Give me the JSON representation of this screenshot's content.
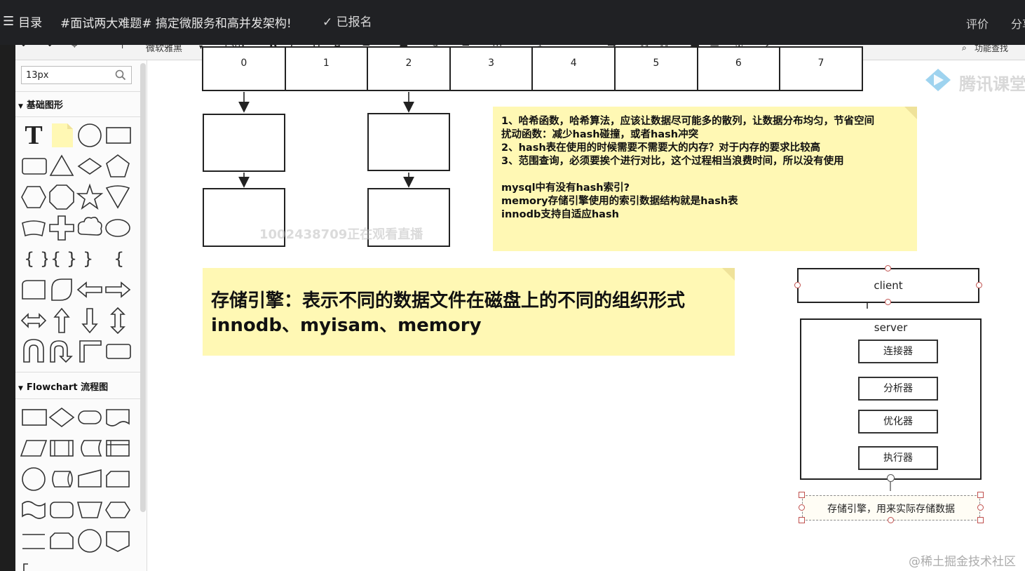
{
  "topbar": {
    "menu_icon": "☰",
    "menu_label": "目录",
    "course_title": "#面试两大难题# 搞定微服务和高并发架构!",
    "enrolled_label": "✓ 已报名",
    "rate_label": "评价",
    "share_label": "分享"
  },
  "toolbar": {
    "font_name": "微软雅黑",
    "font_size": "13px",
    "find_label": "功能查找"
  },
  "panel": {
    "search_value": "13px",
    "section_basic": "基础图形",
    "section_flowchart": "Flowchart 流程图"
  },
  "canvas": {
    "array_indices": [
      "0",
      "1",
      "2",
      "3",
      "4",
      "5",
      "6",
      "7"
    ],
    "note1_lines": [
      "1、哈希函数，哈希算法，应该让数据尽可能多的散列，让数据分布均匀，节省空间",
      "扰动函数：减少hash碰撞，或者hash冲突",
      "2、hash表在使用的时候需要不需要大的内存？对于内存的要求比较高",
      "3、范围查询，必须要挨个进行对比，这个过程相当浪费时间，所以没有使用",
      "",
      "mysql中有没有hash索引?",
      "memory存储引擎使用的索引数据结构就是hash表",
      "innodb支持自适应hash"
    ],
    "note2_lines": [
      "存储引擎：表示不同的数据文件在磁盘上的不同的组织形式",
      "innodb、myisam、memory"
    ],
    "client_label": "client",
    "server_label": "server",
    "components": [
      "连接器",
      "分析器",
      "优化器",
      "执行器"
    ],
    "storage_label": "存储引擎，用来实际存储数据"
  },
  "watermarks": {
    "tencent": "腾讯课堂",
    "viewer_id": "1002438709正在观看直播",
    "juejin": "@稀土掘金技术社区"
  }
}
